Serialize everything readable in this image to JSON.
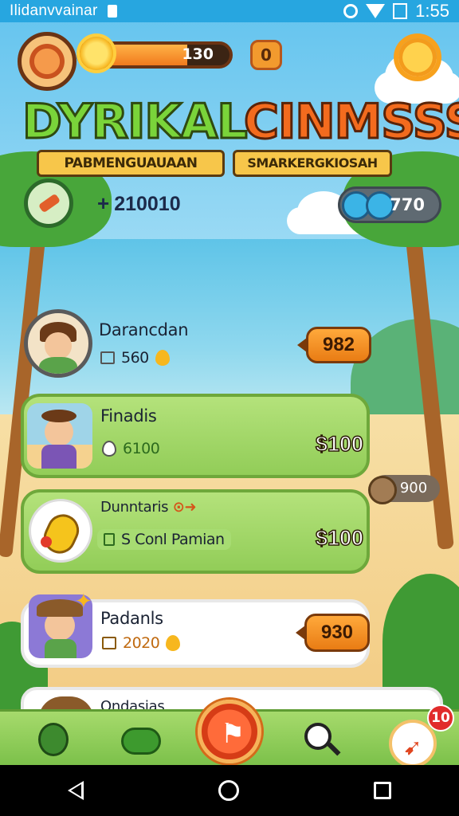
{
  "status_bar": {
    "carrier": "Ilidanvvainar",
    "time": "1:55",
    "icons": [
      "sim-icon",
      "alarm-icon",
      "wifi-icon",
      "battery-icon"
    ]
  },
  "hud": {
    "xp_text": "130",
    "xp_progress": 0.72,
    "coin_label": "0"
  },
  "title": {
    "left": "DYRIKAL",
    "right": "CINMSSS",
    "sub_left": "PABMENGUAUAAN",
    "sub_right": "SMARKERGKIOSAH"
  },
  "stats": {
    "score_prefix": "+",
    "score": "210010",
    "eyes_value": "770"
  },
  "list": [
    {
      "name": "Darancdan",
      "sub_value": "560",
      "price": "982"
    },
    {
      "name": "Finadis",
      "sub_value": "6100",
      "price": "$100"
    },
    {
      "name": "Dunntaris",
      "sub_value": "S Conl Pamian",
      "price": "$100"
    },
    {
      "name": "Padanls",
      "sub_value": "2020",
      "price": "930"
    },
    {
      "name": "Ondasias"
    }
  ],
  "side_badge": "900",
  "tabbar": {
    "notification_count": "10",
    "tabs": [
      "character-tab",
      "bush-tab",
      "play-tab",
      "search-tab",
      "attack-tab"
    ]
  },
  "colors": {
    "status_bar": "#27a6e0",
    "green_card": "#a4d96a",
    "price_orange": "#f28b23",
    "title_green": "#7ad43a",
    "title_orange": "#f36b1e"
  }
}
